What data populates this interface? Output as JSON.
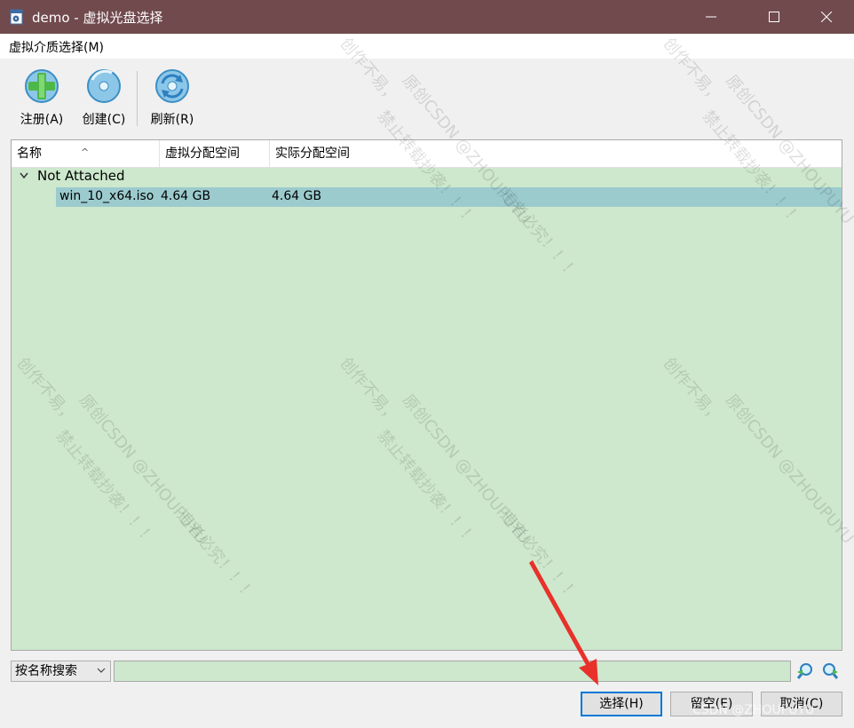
{
  "window": {
    "title": "demo - 虚拟光盘选择",
    "minimize_icon": "minimize-icon",
    "maximize_icon": "maximize-icon",
    "close_icon": "close-icon"
  },
  "menubar": {
    "items": [
      {
        "label": "虚拟介质选择(M)"
      }
    ]
  },
  "toolbar": {
    "register_label": "注册(A)",
    "create_label": "创建(C)",
    "refresh_label": "刷新(R)"
  },
  "list": {
    "columns": [
      "名称",
      "虚拟分配空间",
      "实际分配空间"
    ],
    "sort_indicator": "^",
    "groups": [
      {
        "label": "Not Attached",
        "expanded": true,
        "rows": [
          {
            "name": "win_10_x64.iso",
            "virtual_size": "4.64 GB",
            "actual_size": "4.64 GB",
            "selected": true
          }
        ]
      }
    ]
  },
  "search": {
    "mode": "按名称搜索",
    "value": ""
  },
  "buttons": {
    "choose": "选择(H)",
    "leave_empty": "留空(E)",
    "cancel": "取消(C)"
  },
  "watermark": {
    "lines": [
      "创作不易，",
      "原创CSDN @ZHOUPUYU",
      "禁止转载抄袭！！！",
      "违者必究！！！"
    ],
    "footer": "CSDN @ZHOUPUYU"
  },
  "colors": {
    "titlebar": "#714a4d",
    "list_bg": "#cde8cd",
    "selected_row": "#9ccbce",
    "annotation_arrow": "#e8312a"
  }
}
